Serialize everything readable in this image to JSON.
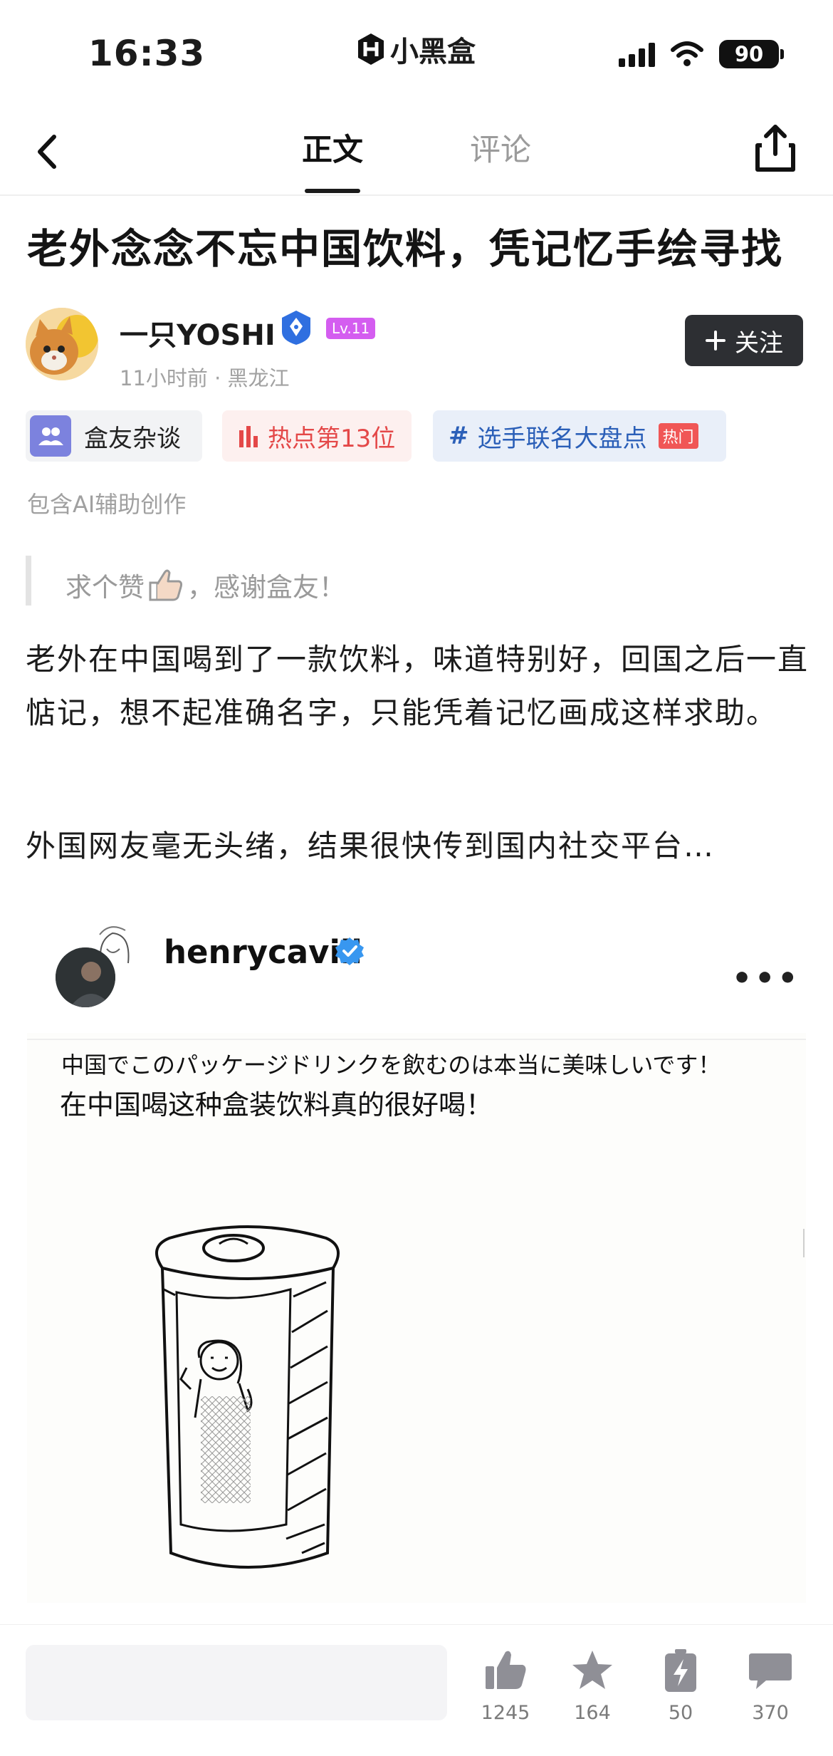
{
  "status_bar": {
    "time": "16:33",
    "app_name": "小黑盒",
    "battery": "90"
  },
  "nav": {
    "tabs": [
      {
        "label": "正文",
        "active": true
      },
      {
        "label": "评论",
        "active": false
      }
    ]
  },
  "article": {
    "title": "老外念念不忘中国饮料，凭记忆手绘寻找",
    "author": {
      "name": "一只YOSHI",
      "level": "Lv.11",
      "meta": "11小时前 · 黑龙江",
      "follow_label": "关注"
    },
    "tags": [
      {
        "label": "盒友杂谈",
        "icon": "users-icon"
      },
      {
        "label": "热点第13位",
        "icon": "bar-chart-icon",
        "color": "#e44848"
      },
      {
        "label": "选手联名大盘点",
        "icon": "hash-icon",
        "badge": "热门",
        "color": "#2b5fb8"
      }
    ],
    "ai_note": "包含AI辅助创作",
    "quote": {
      "before": "求个赞",
      "after": "，感谢盒友！"
    },
    "paragraphs": [
      "老外在中国喝到了一款饮料，味道特别好，回国之后一直惦记，想不起准确名字，只能凭着记忆画成这样求助。",
      "外国网友毫无头绪，结果很快传到国内社交平台…"
    ]
  },
  "embed": {
    "username": "henrycavill",
    "caption_jp": "中国でこのパッケージドリンクを飲むのは本当に美味しいです！",
    "caption_cn": "在中国喝这种盒装饮料真的很好喝！"
  },
  "bottom_bar": {
    "likes": "1245",
    "favorites": "164",
    "charges": "50",
    "comments": "370"
  }
}
